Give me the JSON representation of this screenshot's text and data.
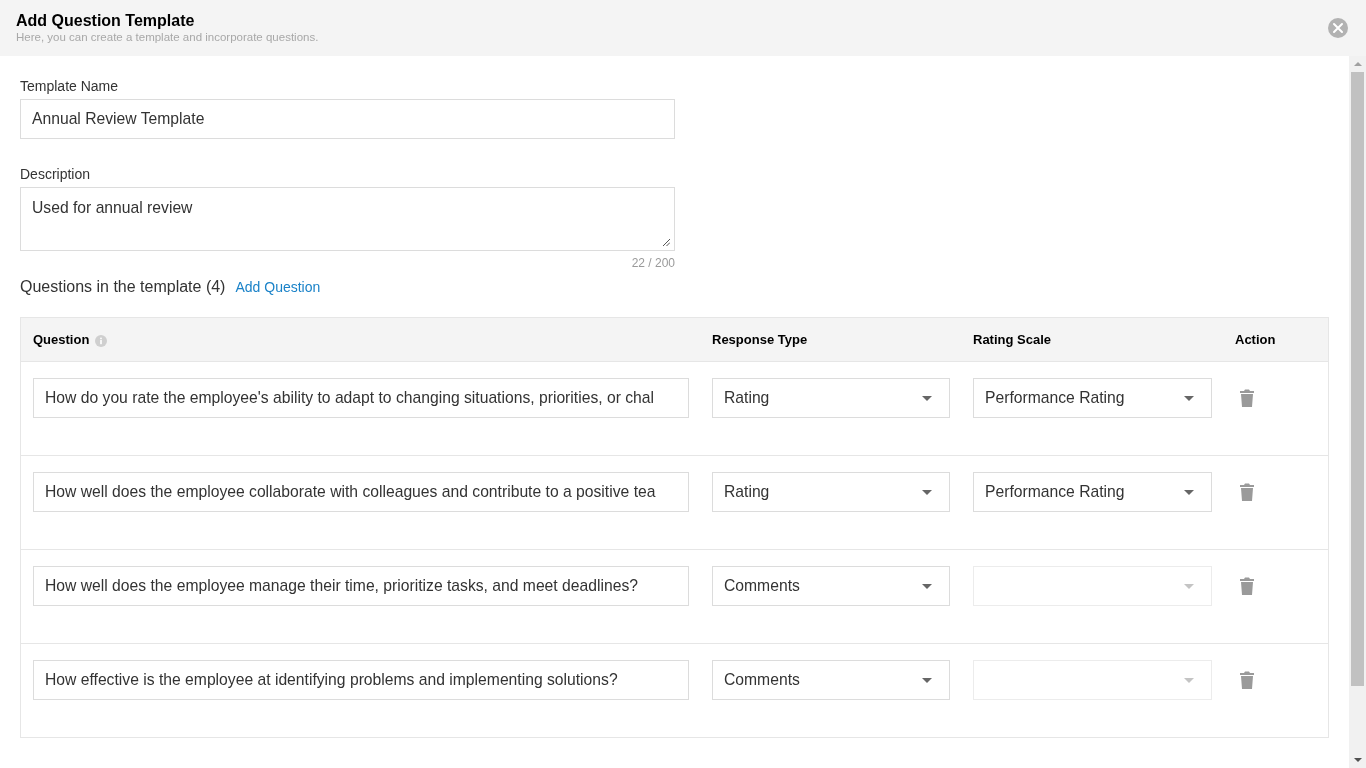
{
  "dialog": {
    "title": "Add Question Template",
    "subtitle": "Here, you can create a template and incorporate questions."
  },
  "form": {
    "template_name": {
      "label": "Template Name",
      "value": "Annual Review Template"
    },
    "description": {
      "label": "Description",
      "value": "Used for annual review",
      "counter": "22 / 200"
    }
  },
  "questions_section": {
    "title": "Questions in the template (4)",
    "add_link": "Add Question"
  },
  "table": {
    "columns": [
      {
        "label": "Question",
        "info": true
      },
      {
        "label": "Response Type",
        "info": false
      },
      {
        "label": "Rating Scale",
        "info": false
      },
      {
        "label": "Action",
        "info": false
      }
    ],
    "rows": [
      {
        "question": "How do you rate the employee's ability to adapt to changing situations, priorities, or chal",
        "response_type": "Rating",
        "rating_scale": {
          "value": "Performance Rating",
          "disabled": false
        }
      },
      {
        "question": "How well does the employee collaborate with colleagues and contribute to a positive tea",
        "response_type": "Rating",
        "rating_scale": {
          "value": "Performance Rating",
          "disabled": false
        }
      },
      {
        "question": "How well does the employee manage their time, prioritize tasks, and meet deadlines?",
        "response_type": "Comments",
        "rating_scale": {
          "disabled": true
        }
      },
      {
        "question": "How effective is the employee at identifying problems and implementing solutions?",
        "response_type": "Comments",
        "rating_scale": {
          "disabled": true
        }
      }
    ]
  }
}
